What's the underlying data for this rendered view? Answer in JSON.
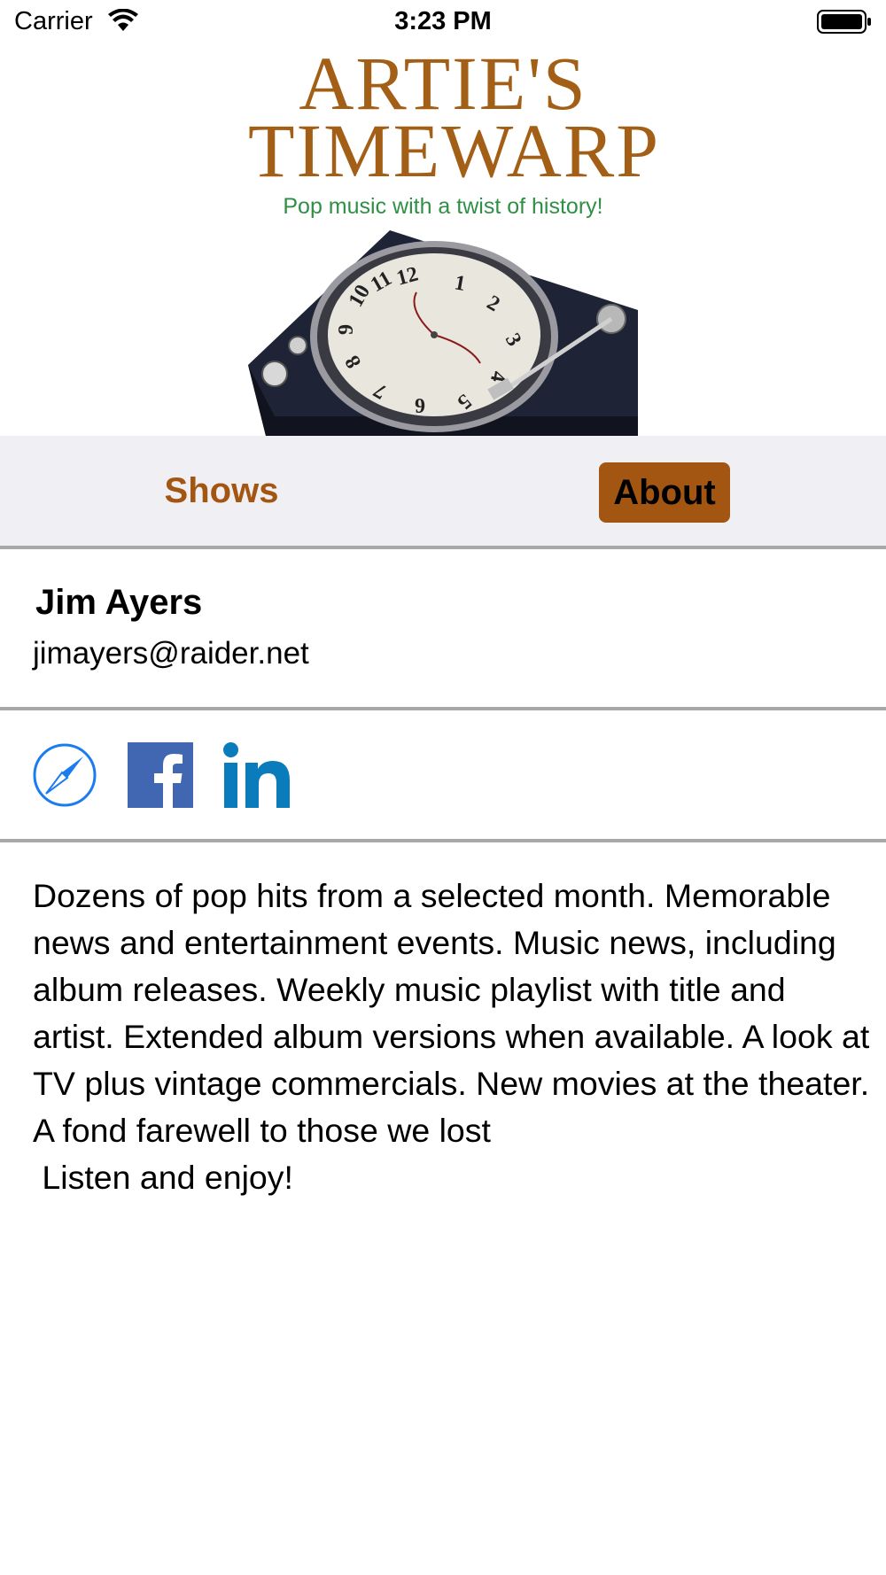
{
  "status_bar": {
    "carrier": "Carrier",
    "time": "3:23 PM"
  },
  "header": {
    "logo_title_line1": "ARTIE'S",
    "logo_title_line2": "TIMEWARP",
    "tagline": "Pop music with a twist of history!",
    "turntable_clock_numerals": [
      "1",
      "2",
      "3",
      "4",
      "5",
      "6",
      "7",
      "8",
      "9",
      "10",
      "11",
      "12"
    ]
  },
  "tabs": [
    {
      "label": "Shows",
      "selected": false
    },
    {
      "label": "About",
      "selected": true
    }
  ],
  "contact": {
    "name": "Jim Ayers",
    "email": "jimayers@raider.net"
  },
  "social_links": [
    {
      "icon": "safari-compass-icon"
    },
    {
      "icon": "facebook-icon"
    },
    {
      "icon": "linkedin-icon"
    }
  ],
  "description": "Dozens of pop hits from a selected month. Memorable news and entertainment events. Music news, including album releases. Weekly music playlist with title and artist. Extended album versions when available. A look at TV plus vintage commercials. New movies at the theater. A fond farewell to those we lost\n Listen and enjoy!",
  "colors": {
    "accent_brown": "#a35512",
    "logo_brown": "#a35f16",
    "tagline_green": "#2f8f46",
    "tab_bar_bg": "#f0eff4",
    "divider": "#a8a8a8",
    "safari_blue": "#1a7cf0",
    "facebook_blue": "#4267b2",
    "linkedin_blue": "#0a7bbb"
  }
}
